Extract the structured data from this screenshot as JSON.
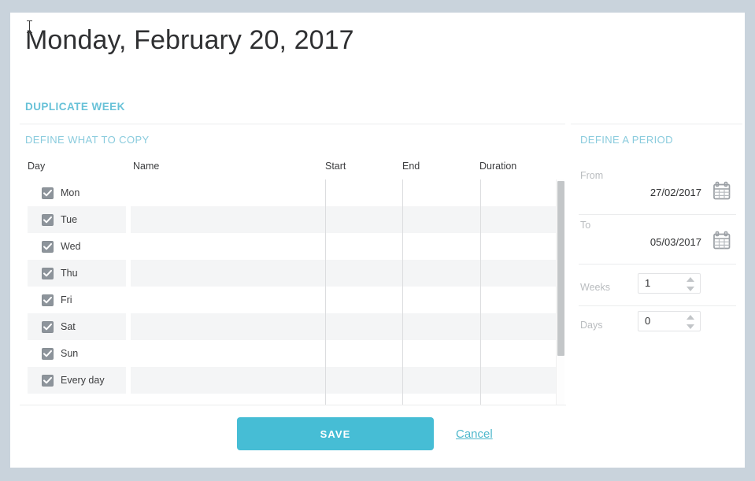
{
  "page": {
    "title": "Monday, February 20, 2017",
    "section_heading": "DUPLICATE WEEK"
  },
  "copy_section": {
    "subheading": "DEFINE WHAT TO COPY",
    "columns": {
      "day": "Day",
      "name": "Name",
      "start": "Start",
      "end": "End",
      "duration": "Duration"
    },
    "rows": [
      {
        "label": "Mon",
        "checked": true,
        "name": "",
        "start": "",
        "end": "",
        "duration": ""
      },
      {
        "label": "Tue",
        "checked": true,
        "name": "",
        "start": "",
        "end": "",
        "duration": ""
      },
      {
        "label": "Wed",
        "checked": true,
        "name": "",
        "start": "",
        "end": "",
        "duration": ""
      },
      {
        "label": "Thu",
        "checked": true,
        "name": "",
        "start": "",
        "end": "",
        "duration": ""
      },
      {
        "label": "Fri",
        "checked": true,
        "name": "",
        "start": "",
        "end": "",
        "duration": ""
      },
      {
        "label": "Sat",
        "checked": true,
        "name": "",
        "start": "",
        "end": "",
        "duration": ""
      },
      {
        "label": "Sun",
        "checked": true,
        "name": "",
        "start": "",
        "end": "",
        "duration": ""
      },
      {
        "label": "Every day",
        "checked": true,
        "name": "",
        "start": "",
        "end": "",
        "duration": ""
      }
    ]
  },
  "period_section": {
    "subheading": "DEFINE A PERIOD",
    "from": {
      "label": "From",
      "value": "27/02/2017",
      "icon": "calendar-icon"
    },
    "to": {
      "label": "To",
      "value": "05/03/2017",
      "icon": "calendar-icon"
    },
    "weeks": {
      "label": "Weeks",
      "value": "1"
    },
    "days": {
      "label": "Days",
      "value": "0"
    }
  },
  "footer": {
    "save_label": "SAVE",
    "cancel_label": "Cancel"
  },
  "colors": {
    "accent": "#46bdd5",
    "heading": "#68c2d8",
    "subheading": "#89cbdd",
    "link": "#4fb8cc",
    "page_background": "#c9d3dc",
    "row_alt": "#f4f5f6",
    "checkbox": "#8d949b"
  }
}
